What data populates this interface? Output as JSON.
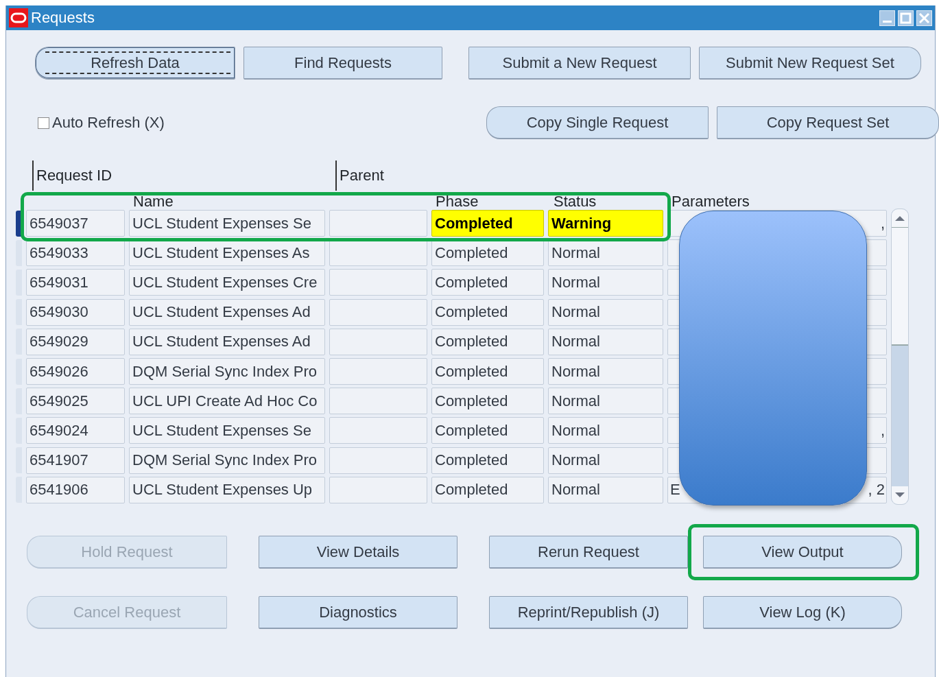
{
  "window": {
    "title": "Requests"
  },
  "top_buttons": [
    {
      "label": "Refresh Data",
      "focused": true,
      "disabled": false
    },
    {
      "label": "Find Requests",
      "focused": false,
      "disabled": false
    },
    {
      "label": "Submit a New Request",
      "focused": false,
      "disabled": false
    },
    {
      "label": "Submit New Request Set",
      "focused": false,
      "disabled": false
    }
  ],
  "auto_refresh": {
    "label": "Auto Refresh (X)",
    "checked": false
  },
  "copy_buttons": [
    {
      "label": "Copy Single Request",
      "focused": false,
      "disabled": false
    },
    {
      "label": "Copy Request Set",
      "focused": false,
      "disabled": false
    }
  ],
  "table": {
    "header_top": [
      "Request ID",
      "Parent"
    ],
    "columns": [
      "Name",
      "Phase",
      "Status",
      "Parameters"
    ],
    "rows": [
      {
        "selected": true,
        "highlight": true,
        "id": "6549037",
        "name": "UCL Student Expenses Se",
        "parent": "",
        "phase": "Completed",
        "status": "Warning",
        "alert": true,
        "param_start": "",
        "param_end": ","
      },
      {
        "selected": false,
        "highlight": false,
        "id": "6549033",
        "name": "UCL Student Expenses As",
        "parent": "",
        "phase": "Completed",
        "status": "Normal",
        "alert": false,
        "param_start": "",
        "param_end": ""
      },
      {
        "selected": false,
        "highlight": false,
        "id": "6549031",
        "name": "UCL Student Expenses Cre",
        "parent": "",
        "phase": "Completed",
        "status": "Normal",
        "alert": false,
        "param_start": "",
        "param_end": ""
      },
      {
        "selected": false,
        "highlight": false,
        "id": "6549030",
        "name": "UCL Student Expenses Ad",
        "parent": "",
        "phase": "Completed",
        "status": "Normal",
        "alert": false,
        "param_start": "",
        "param_end": ""
      },
      {
        "selected": false,
        "highlight": false,
        "id": "6549029",
        "name": "UCL Student Expenses Ad",
        "parent": "",
        "phase": "Completed",
        "status": "Normal",
        "alert": false,
        "param_start": "",
        "param_end": ""
      },
      {
        "selected": false,
        "highlight": false,
        "id": "6549026",
        "name": "DQM Serial Sync Index Pro",
        "parent": "",
        "phase": "Completed",
        "status": "Normal",
        "alert": false,
        "param_start": "",
        "param_end": ""
      },
      {
        "selected": false,
        "highlight": false,
        "id": "6549025",
        "name": "UCL UPI Create Ad Hoc Co",
        "parent": "",
        "phase": "Completed",
        "status": "Normal",
        "alert": false,
        "param_start": "",
        "param_end": ""
      },
      {
        "selected": false,
        "highlight": false,
        "id": "6549024",
        "name": "UCL Student Expenses Se",
        "parent": "",
        "phase": "Completed",
        "status": "Normal",
        "alert": false,
        "param_start": "",
        "param_end": ","
      },
      {
        "selected": false,
        "highlight": false,
        "id": "6541907",
        "name": "DQM Serial Sync Index Pro",
        "parent": "",
        "phase": "Completed",
        "status": "Normal",
        "alert": false,
        "param_start": "",
        "param_end": ""
      },
      {
        "selected": false,
        "highlight": false,
        "id": "6541906",
        "name": "UCL Student Expenses Up",
        "parent": "",
        "phase": "Completed",
        "status": "Normal",
        "alert": false,
        "param_start": "E",
        "param_end": ", 2"
      }
    ]
  },
  "action_buttons": [
    [
      {
        "label": "Hold Request",
        "focused": false,
        "disabled": true,
        "highlight": false
      },
      {
        "label": "View Details",
        "focused": false,
        "disabled": false,
        "highlight": false
      },
      {
        "label": "Rerun Request",
        "focused": false,
        "disabled": false,
        "highlight": false
      },
      {
        "label": "View Output",
        "focused": false,
        "disabled": false,
        "highlight": true
      }
    ],
    [
      {
        "label": "Cancel Request",
        "focused": false,
        "disabled": true,
        "highlight": false
      },
      {
        "label": "Diagnostics",
        "focused": false,
        "disabled": false,
        "highlight": false
      },
      {
        "label": "Reprint/Republish (J)",
        "focused": false,
        "disabled": false,
        "highlight": false
      },
      {
        "label": "View Log (K)",
        "focused": false,
        "disabled": false,
        "highlight": false
      }
    ]
  ]
}
